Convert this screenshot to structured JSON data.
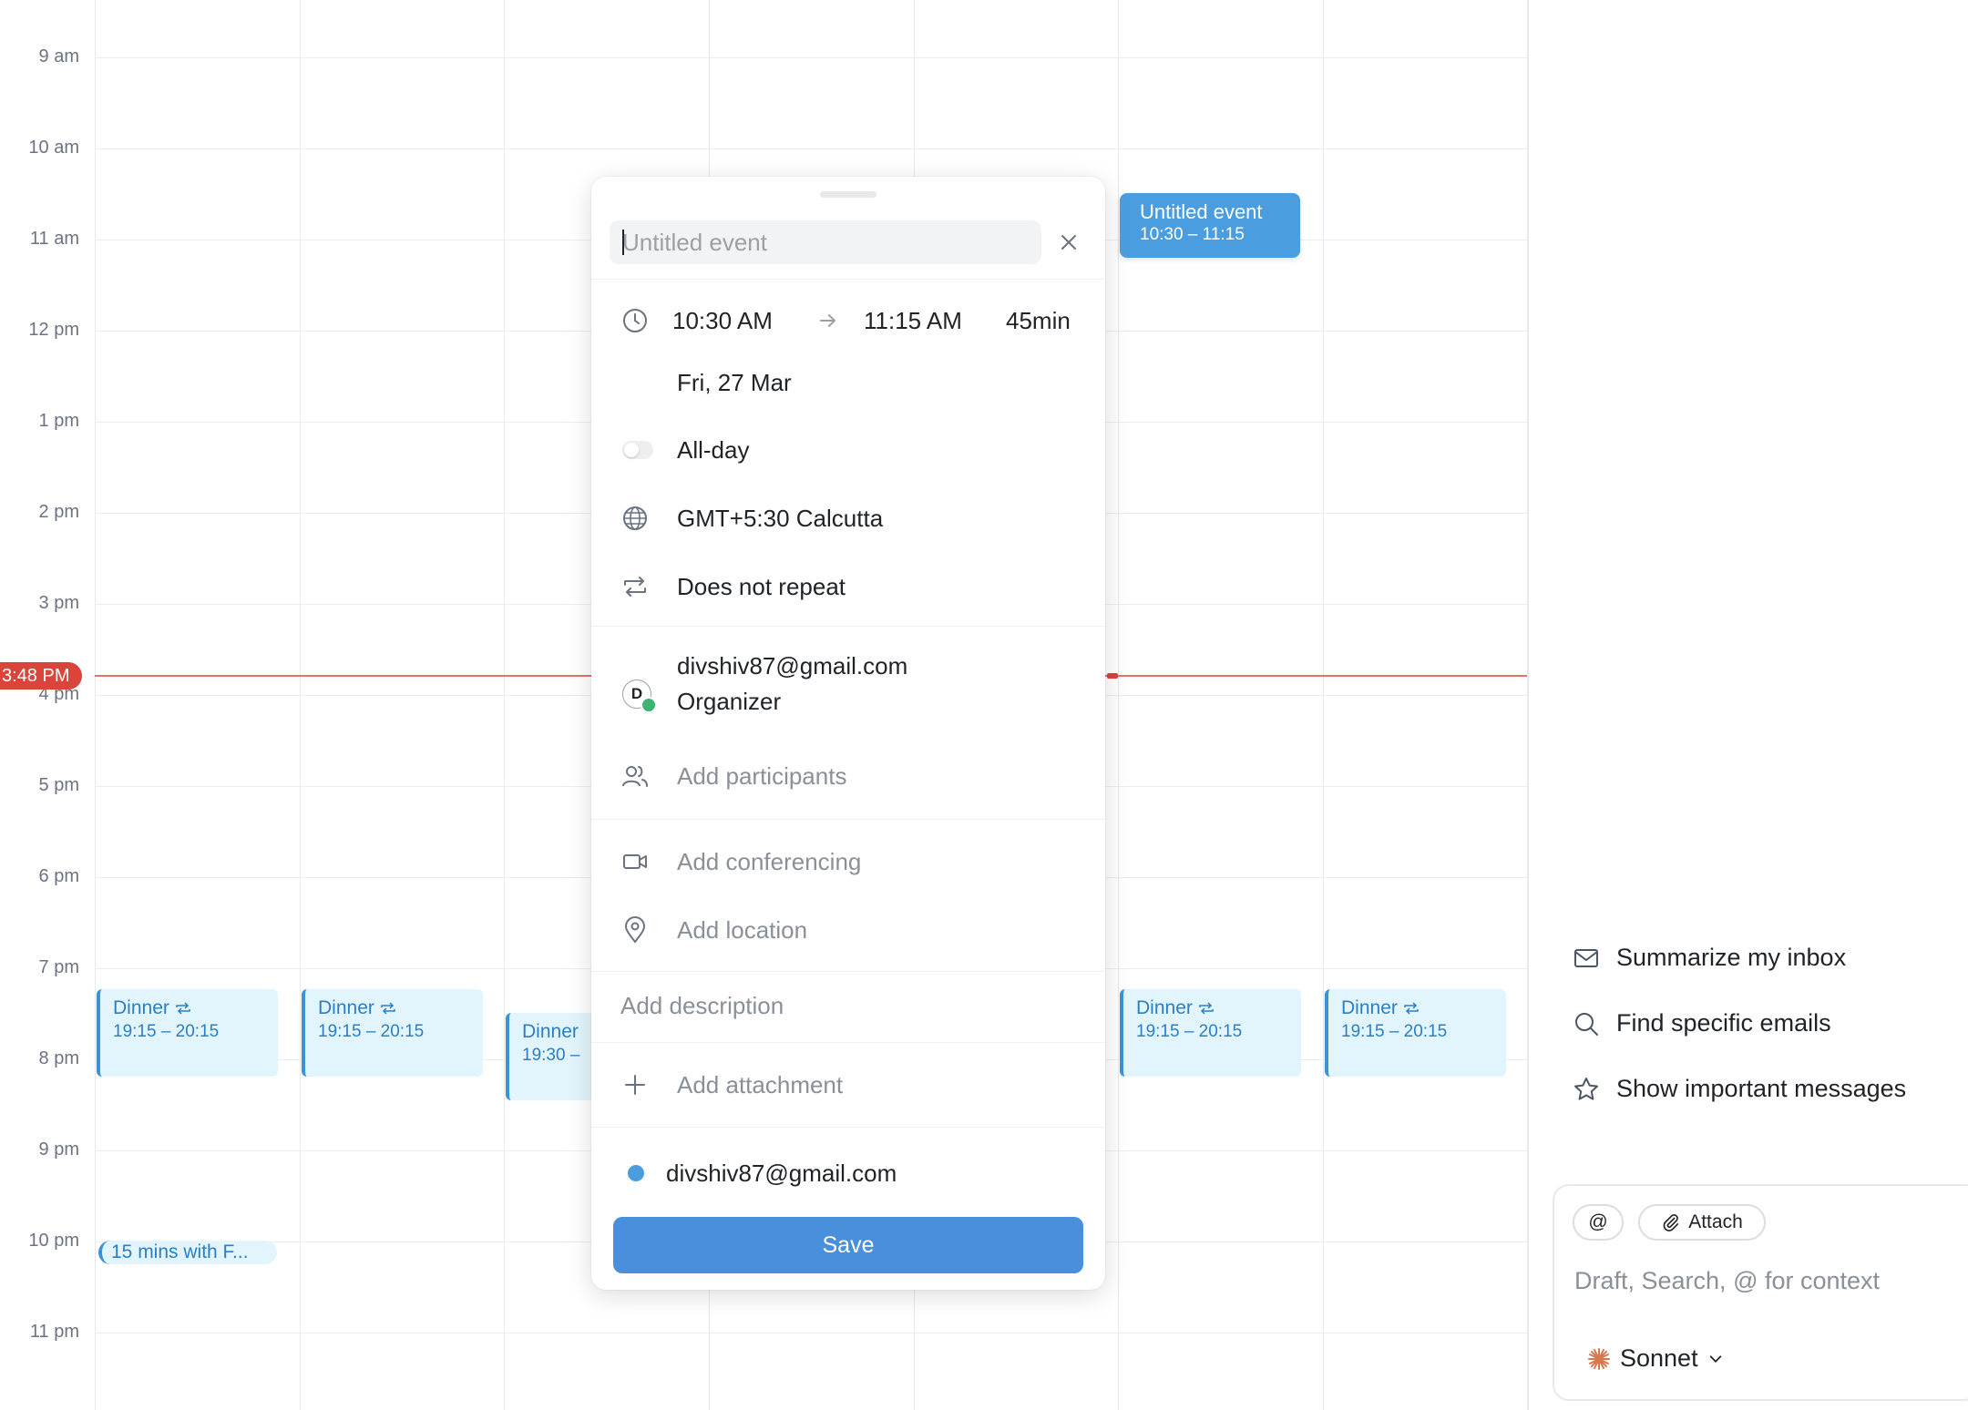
{
  "calendar": {
    "hours": [
      "9 am",
      "10 am",
      "11 am",
      "12 pm",
      "1 pm",
      "2 pm",
      "3 pm",
      "4 pm",
      "5 pm",
      "6 pm",
      "7 pm",
      "8 pm",
      "9 pm",
      "10 pm",
      "11 pm"
    ],
    "now_label": "3:48 PM",
    "events": {
      "dinner1": {
        "title": "Dinner",
        "time": "19:15 – 20:15"
      },
      "dinner2": {
        "title": "Dinner",
        "time": "19:15 – 20:15"
      },
      "dinner3": {
        "title": "Dinner",
        "time": "19:30 –"
      },
      "dinner4": {
        "title": "Dinner",
        "time": "19:15 – 20:15"
      },
      "dinner5": {
        "title": "Dinner",
        "time": "19:15 – 20:15"
      },
      "short_event": {
        "title": "15 mins with F..."
      },
      "selected": {
        "title": "Untitled event",
        "time": "10:30 – 11:15"
      }
    },
    "colors": {
      "event_bg": "#e3f5fc",
      "event_accent": "#3b93d6",
      "now_line": "#d9453a",
      "selected_bg": "#4a9ee0"
    }
  },
  "popover": {
    "title_placeholder": "Untitled event",
    "title_value": "",
    "start_time": "10:30 AM",
    "end_time": "11:15 AM",
    "duration": "45min",
    "date": "Fri, 27 Mar",
    "all_day_label": "All-day",
    "all_day_on": false,
    "timezone": "GMT+5:30 Calcutta",
    "repeat": "Does not repeat",
    "organizer_initial": "D",
    "organizer_email": "divshiv87@gmail.com",
    "organizer_role": "Organizer",
    "add_participants": "Add participants",
    "add_conferencing": "Add conferencing",
    "add_location": "Add location",
    "add_description": "Add description",
    "add_attachment": "Add attachment",
    "calendar_account": "divshiv87@gmail.com",
    "save_label": "Save",
    "colors": {
      "save": "#4a8fdb",
      "calendar_dot": "#4a9ee0",
      "organizer_check": "#3db374"
    }
  },
  "assistant": {
    "suggestions": [
      {
        "label": "Summarize my inbox",
        "icon": "mail-icon"
      },
      {
        "label": "Find specific emails",
        "icon": "search-icon"
      },
      {
        "label": "Show important messages",
        "icon": "star-icon"
      }
    ],
    "mention_chip": "@",
    "attach_chip": "Attach",
    "input_placeholder": "Draft, Search, @ for context",
    "model": "Sonnet",
    "colors": {
      "model_icon": "#d9774f"
    }
  }
}
